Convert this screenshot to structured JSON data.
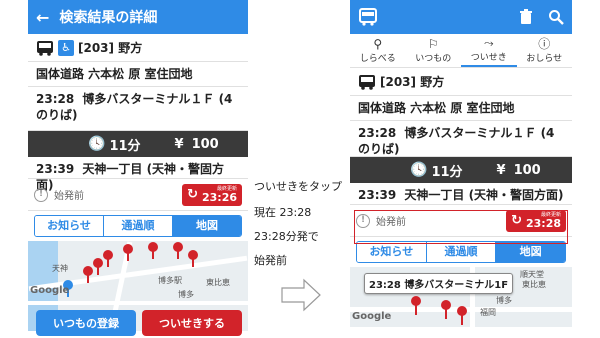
{
  "left": {
    "appbar": {
      "back": "←",
      "title": "検索結果の詳細"
    },
    "route": {
      "number": "[203] 野方"
    },
    "via": "国体道路 六本松 原 室住団地",
    "depart": {
      "time": "23:28",
      "place": "博多バスターミナル１Ｆ (4のりば)"
    },
    "duration": "11分",
    "fare": "100",
    "yen": "¥",
    "arrive": {
      "time": "23:39",
      "place": "天神一丁目 (天神・警固方面)"
    },
    "status": "始発前",
    "refresh": {
      "small": "最終更新",
      "time": "23:26"
    },
    "tabs": [
      "お知らせ",
      "通過順",
      "地図"
    ],
    "map_labels": {
      "tenjin": "天神",
      "hakata_eki": "博多駅",
      "higashihie": "東比恵",
      "hakata": "博多"
    },
    "google": "Google",
    "buttons": {
      "itsumo": "いつもの登録",
      "tsuiseki": "ついせきする"
    }
  },
  "middle": {
    "line1": "ついせきをタップ",
    "line2": "現在 23:28",
    "line3": "23:28分発で",
    "line4": "始発前"
  },
  "right": {
    "toptabs": [
      {
        "icon": "🔍",
        "label": "しらべる"
      },
      {
        "icon": "🚏",
        "label": "いつもの"
      },
      {
        "icon": "ᓭ",
        "label": "ついせき"
      },
      {
        "icon": "ⓘ",
        "label": "おしらせ"
      }
    ],
    "route": {
      "number": "[203] 野方"
    },
    "via": "国体道路 六本松 原 室住団地",
    "depart": {
      "time": "23:28",
      "place": "博多バスターミナル１Ｆ (4のりば)"
    },
    "duration": "11分",
    "fare": "100",
    "yen": "¥",
    "arrive": {
      "time": "23:39",
      "place": "天神一丁目 (天神・警固方面)"
    },
    "status": "始発前",
    "refresh": {
      "small": "最終更新",
      "time": "23:28"
    },
    "tabs": [
      "お知らせ",
      "通過順",
      "地図"
    ],
    "map_callout": "23:28 博多バスターミナル1F",
    "map_labels": {
      "juntendo": "順天堂",
      "higashihie": "東比恵",
      "hakata": "博多",
      "fukuoka": "福岡"
    },
    "google": "Google"
  },
  "colors": {
    "primary": "#2f8be6",
    "red": "#d2232a",
    "dark": "#3a3a3a"
  }
}
